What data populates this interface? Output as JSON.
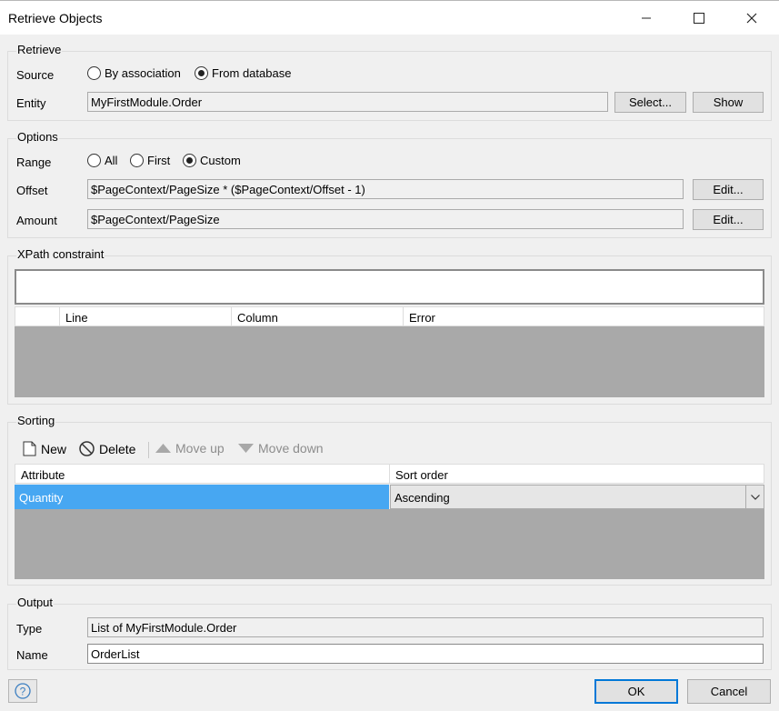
{
  "window": {
    "title": "Retrieve Objects",
    "minimize_icon": "minimize-icon",
    "maximize_icon": "maximize-icon",
    "close_icon": "close-icon"
  },
  "retrieve": {
    "title": "Retrieve",
    "source_label": "Source",
    "source_options": [
      "By association",
      "From database"
    ],
    "source_selected": "From database",
    "entity_label": "Entity",
    "entity_value": "MyFirstModule.Order",
    "select_button": "Select...",
    "show_button": "Show"
  },
  "options": {
    "title": "Options",
    "range_label": "Range",
    "range_options": [
      "All",
      "First",
      "Custom"
    ],
    "range_selected": "Custom",
    "offset_label": "Offset",
    "offset_value": "$PageContext/PageSize * ($PageContext/Offset - 1)",
    "amount_label": "Amount",
    "amount_value": "$PageContext/PageSize",
    "edit_button": "Edit..."
  },
  "xpath": {
    "title": "XPath constraint",
    "value": "",
    "columns": [
      "",
      "Line",
      "Column",
      "Error"
    ]
  },
  "sorting": {
    "title": "Sorting",
    "toolbar": {
      "new": "New",
      "delete": "Delete",
      "move_up": "Move up",
      "move_down": "Move down"
    },
    "columns": [
      "Attribute",
      "Sort order"
    ],
    "rows": [
      {
        "attribute": "Quantity",
        "sort_order": "Ascending"
      }
    ],
    "selection_color": "#47a7f2"
  },
  "output": {
    "title": "Output",
    "type_label": "Type",
    "type_value": "List of MyFirstModule.Order",
    "name_label": "Name",
    "name_value": "OrderList"
  },
  "footer": {
    "ok": "OK",
    "cancel": "Cancel",
    "help_icon": "help-icon"
  }
}
